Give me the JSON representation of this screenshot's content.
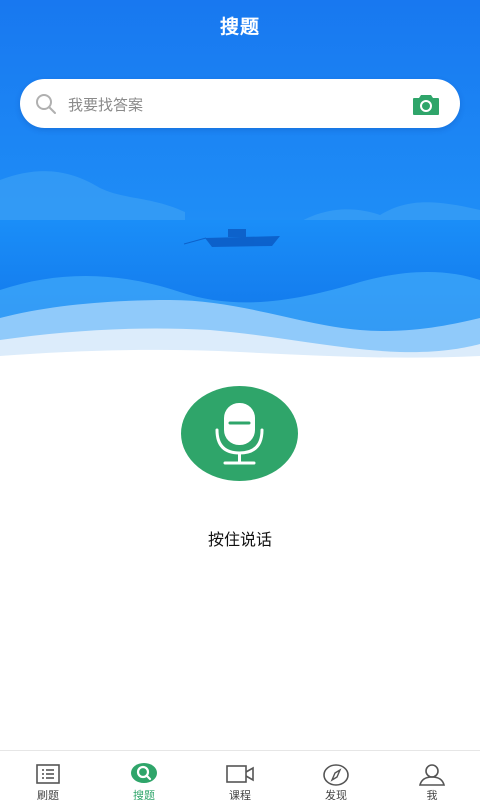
{
  "header": {
    "title": "搜题"
  },
  "search": {
    "placeholder": "我要找答案",
    "search_icon": "search-icon",
    "camera_icon": "camera-icon"
  },
  "voice": {
    "label": "按住说话",
    "icon": "microphone-icon"
  },
  "tabbar": {
    "active": "搜题",
    "items": [
      {
        "label": "刷题",
        "icon": "list-icon"
      },
      {
        "label": "搜题",
        "icon": "search-bubble-icon"
      },
      {
        "label": "课程",
        "icon": "video-camera-icon"
      },
      {
        "label": "发现",
        "icon": "compass-icon"
      },
      {
        "label": "我",
        "icon": "person-icon"
      }
    ]
  },
  "colors": {
    "accent": "#2fa56a",
    "hero_top": "#1e7ef0",
    "hero_bottom": "#1a8cf5"
  }
}
